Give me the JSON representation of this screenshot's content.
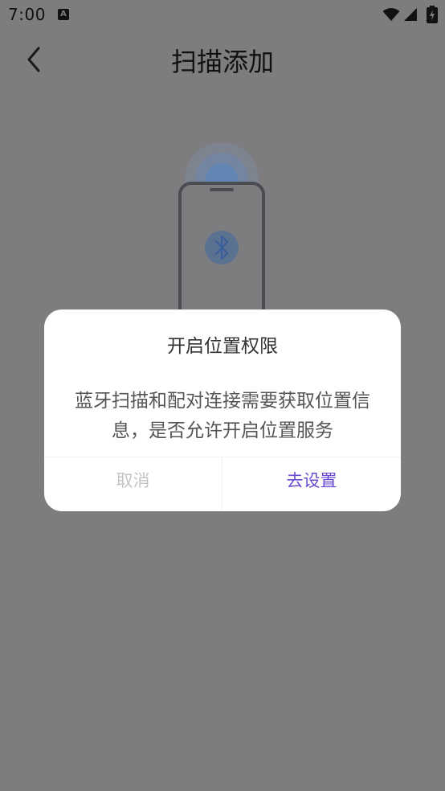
{
  "status_bar": {
    "time": "7:00",
    "notification_badge": "A",
    "icons": [
      "wifi-icon",
      "signal-icon",
      "battery-icon"
    ]
  },
  "header": {
    "title": "扫描添加",
    "back_icon": "chevron-left-icon"
  },
  "illustration": {
    "icon": "bluetooth-icon",
    "accent_color": "#3a7bd5"
  },
  "dialog": {
    "title": "开启位置权限",
    "message_line1": "蓝牙扫描和配对连接需要获取位置信",
    "message_line2": "息，是否允许开启位置服务",
    "cancel_label": "取消",
    "confirm_label": "去设置",
    "confirm_color": "#6a4bd0"
  }
}
